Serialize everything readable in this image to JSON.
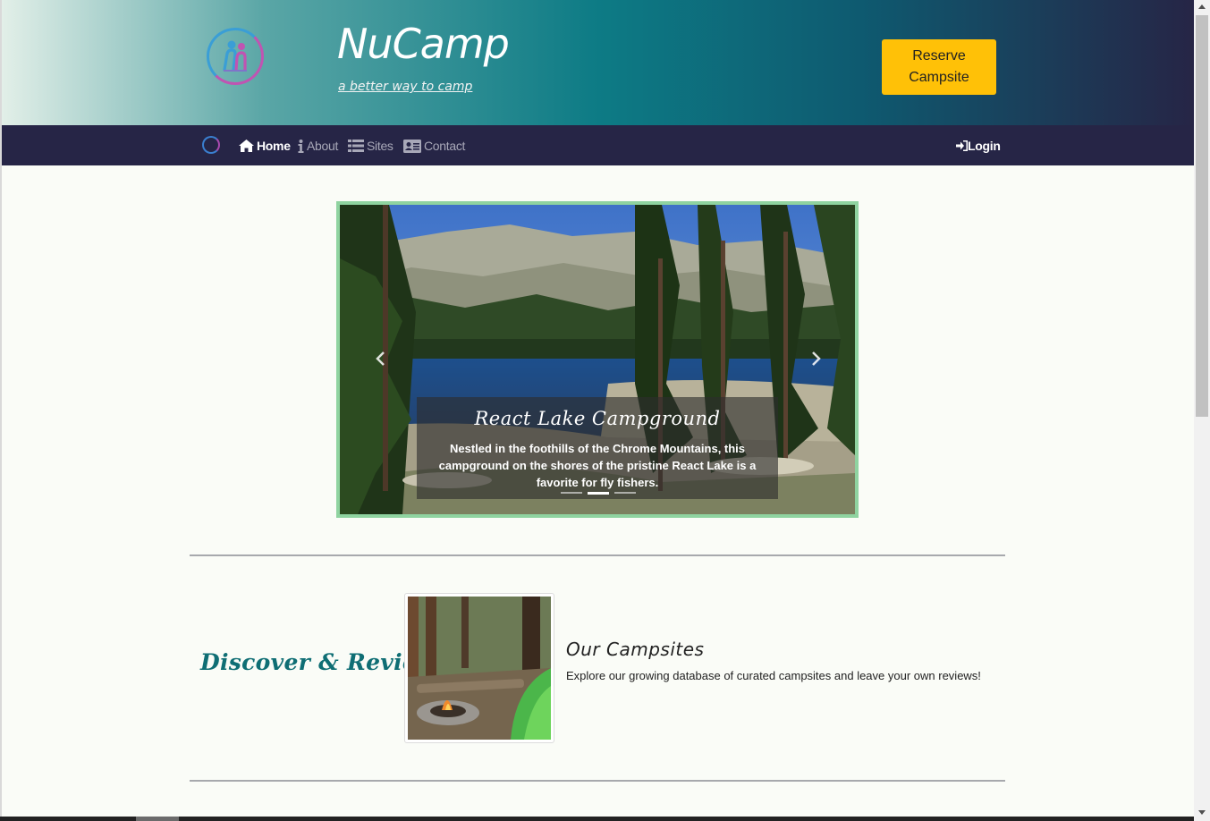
{
  "header": {
    "brand_title": "NuCamp",
    "tagline": "a better way to camp",
    "reserve_label": "Reserve Campsite",
    "logo_icon": "nucamp-logo-icon",
    "colors": {
      "reserve_button": "#ffc107",
      "navbar": "#262546",
      "accent": "#0f6e74"
    }
  },
  "navbar": {
    "items": [
      {
        "label": "Home",
        "icon": "home-icon",
        "active": true
      },
      {
        "label": "About",
        "icon": "info-icon",
        "active": false
      },
      {
        "label": "Sites",
        "icon": "list-icon",
        "active": false
      },
      {
        "label": "Contact",
        "icon": "address-card-icon",
        "active": false
      }
    ],
    "login_label": "Login",
    "login_icon": "sign-in-icon"
  },
  "carousel": {
    "caption_title": "React Lake Campground",
    "caption_text": "Nestled in the foothills of the Chrome Mountains, this campground on the shores of the pristine React Lake is a favorite for fly fishers.",
    "slide_count": 3,
    "active_index": 1,
    "border_color": "#8fd3a0"
  },
  "section": {
    "title": "Discover & Review",
    "media_heading": "Our Campsites",
    "media_text": "Explore our growing database of curated campsites and leave your own reviews!"
  }
}
